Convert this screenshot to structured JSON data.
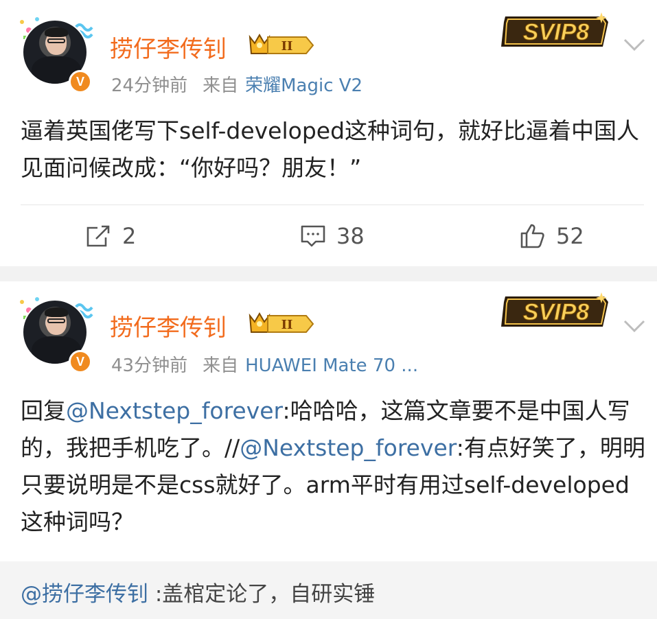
{
  "posts": [
    {
      "username": "捞仔李传钊",
      "time": "24分钟前",
      "from_label": "来自",
      "device": "荣耀Magic V2",
      "text": "逼着英国佬写下self-developed这种词句，就好比逼着中国人见面问候改成：“你好吗？朋友！”",
      "repost_count": "2",
      "comment_count": "38",
      "like_count": "52",
      "rank_badge": "II",
      "svip_label": "SVIP8"
    },
    {
      "username": "捞仔李传钊",
      "time": "43分钟前",
      "from_label": "来自",
      "device": "HUAWEI Mate 70 ...",
      "rank_badge": "II",
      "svip_label": "SVIP8",
      "content": {
        "reply_prefix": "回复",
        "mention1": "@Nextstep_forever",
        "text1": ":哈哈哈，这篇文章要不是中国人写的，我把手机吃了。//",
        "mention2": "@Nextstep_forever",
        "text2": ":有点好笑了，明明只要说明是不是css就好了。arm平时有用过self-developed这种词吗？"
      },
      "quote": {
        "mention": "@捞仔李传钊",
        "text": " :盖棺定论了，自研实锤"
      }
    }
  ],
  "icons": {
    "repost": "repost-icon",
    "comment": "comment-icon",
    "like": "thumbs-up-icon",
    "chevron": "chevron-down-icon",
    "verified": "verified-v-icon",
    "crown": "crown-icon"
  },
  "colors": {
    "username": "#f26b1d",
    "mention": "#3d6fa3",
    "meta": "#8f8f8f",
    "verified": "#f08a1f"
  }
}
